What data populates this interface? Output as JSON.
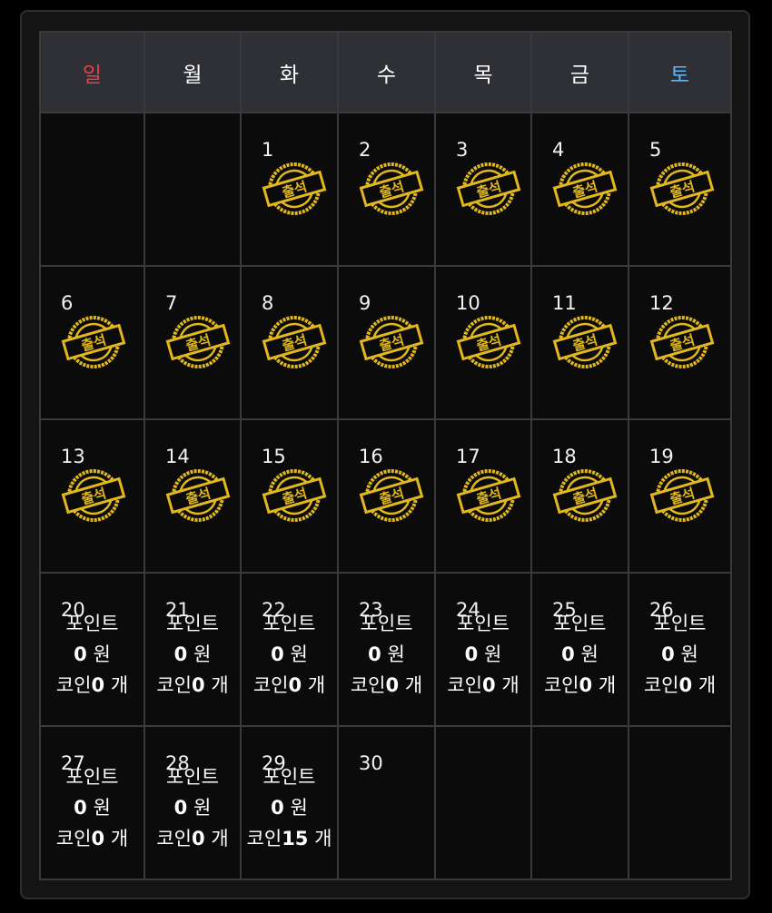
{
  "calendar": {
    "weekdays": [
      "일",
      "월",
      "화",
      "수",
      "목",
      "금",
      "토"
    ],
    "stamp_label": "출석",
    "colors": {
      "sunday": "#e14444",
      "saturday": "#62b6ef",
      "stamp_gold": "#e2b81c",
      "header_bg": "#2e3035",
      "cell_bg": "#0b0b0b"
    },
    "reward_labels": {
      "points": "포인트",
      "won_unit": "원",
      "coin": "코인",
      "coin_unit": "개"
    },
    "weeks": [
      [
        {
          "day": ""
        },
        {
          "day": ""
        },
        {
          "day": "1",
          "stamp": true
        },
        {
          "day": "2",
          "stamp": true
        },
        {
          "day": "3",
          "stamp": true
        },
        {
          "day": "4",
          "stamp": true
        },
        {
          "day": "5",
          "stamp": true
        }
      ],
      [
        {
          "day": "6",
          "stamp": true
        },
        {
          "day": "7",
          "stamp": true
        },
        {
          "day": "8",
          "stamp": true
        },
        {
          "day": "9",
          "stamp": true
        },
        {
          "day": "10",
          "stamp": true
        },
        {
          "day": "11",
          "stamp": true
        },
        {
          "day": "12",
          "stamp": true
        }
      ],
      [
        {
          "day": "13",
          "stamp": true
        },
        {
          "day": "14",
          "stamp": true
        },
        {
          "day": "15",
          "stamp": true
        },
        {
          "day": "16",
          "stamp": true
        },
        {
          "day": "17",
          "stamp": true
        },
        {
          "day": "18",
          "stamp": true
        },
        {
          "day": "19",
          "stamp": true
        }
      ],
      [
        {
          "day": "20",
          "reward": {
            "points": "0",
            "coins": "0"
          }
        },
        {
          "day": "21",
          "reward": {
            "points": "0",
            "coins": "0"
          }
        },
        {
          "day": "22",
          "reward": {
            "points": "0",
            "coins": "0"
          }
        },
        {
          "day": "23",
          "reward": {
            "points": "0",
            "coins": "0"
          }
        },
        {
          "day": "24",
          "reward": {
            "points": "0",
            "coins": "0"
          }
        },
        {
          "day": "25",
          "reward": {
            "points": "0",
            "coins": "0"
          }
        },
        {
          "day": "26",
          "reward": {
            "points": "0",
            "coins": "0"
          }
        }
      ],
      [
        {
          "day": "27",
          "reward": {
            "points": "0",
            "coins": "0"
          }
        },
        {
          "day": "28",
          "reward": {
            "points": "0",
            "coins": "0"
          }
        },
        {
          "day": "29",
          "reward": {
            "points": "0",
            "coins": "15"
          }
        },
        {
          "day": "30"
        },
        {
          "day": ""
        },
        {
          "day": ""
        },
        {
          "day": ""
        }
      ]
    ]
  }
}
